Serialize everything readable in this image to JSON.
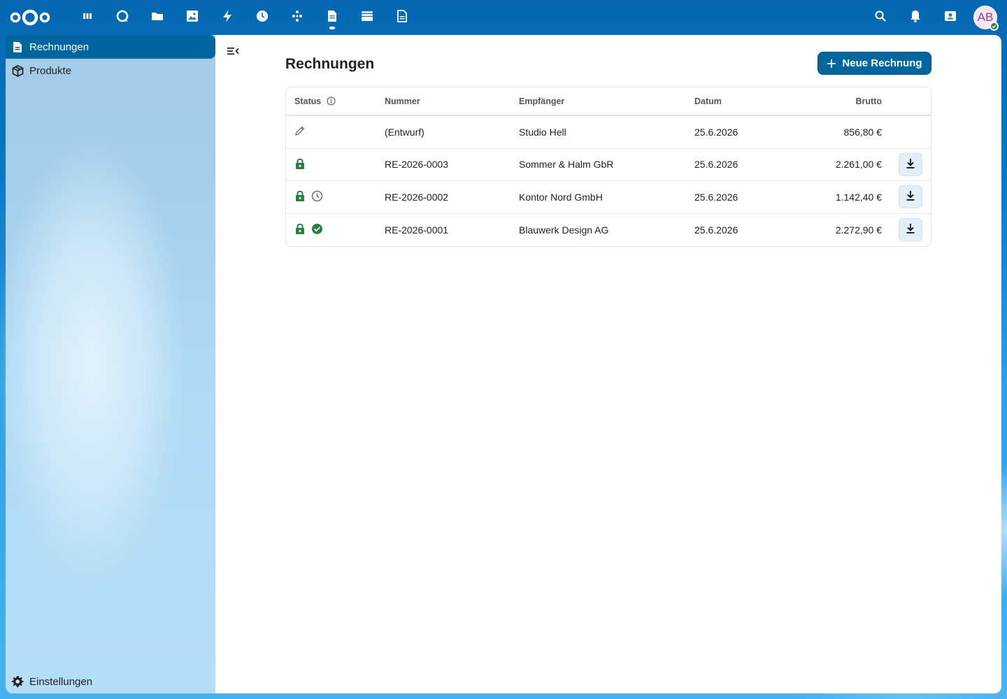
{
  "header": {
    "apps": [
      {
        "name": "dashboard"
      },
      {
        "name": "talk"
      },
      {
        "name": "files"
      },
      {
        "name": "photos"
      },
      {
        "name": "activity"
      },
      {
        "name": "timemanagement"
      },
      {
        "name": "flow"
      },
      {
        "name": "invoices",
        "active": true
      },
      {
        "name": "archive"
      },
      {
        "name": "document"
      }
    ],
    "avatar_initials": "AB"
  },
  "nav": {
    "items": [
      {
        "label": "Rechnungen",
        "active": true
      },
      {
        "label": "Produkte",
        "active": false
      }
    ],
    "settings_label": "Einstellungen"
  },
  "main": {
    "title": "Rechnungen",
    "new_button_label": "Neue Rechnung",
    "table": {
      "columns": {
        "status": "Status",
        "number": "Nummer",
        "recipient": "Empfänger",
        "date": "Datum",
        "gross": "Brutto"
      },
      "rows": [
        {
          "status": [
            "draft"
          ],
          "number": "(Entwurf)",
          "recipient": "Studio Hell",
          "date": "25.6.2026",
          "gross": "856,80 €",
          "download": false
        },
        {
          "status": [
            "locked"
          ],
          "number": "RE-2026-0003",
          "recipient": "Sommer & Halm GbR",
          "date": "25.6.2026",
          "gross": "2.261,00 €",
          "download": true
        },
        {
          "status": [
            "locked",
            "pending"
          ],
          "number": "RE-2026-0002",
          "recipient": "Kontor Nord GmbH",
          "date": "25.6.2026",
          "gross": "1.142,40 €",
          "download": true
        },
        {
          "status": [
            "locked",
            "paid"
          ],
          "number": "RE-2026-0001",
          "recipient": "Blauwerk Design AG",
          "date": "25.6.2026",
          "gross": "2.272,90 €",
          "download": true
        }
      ]
    }
  },
  "colors": {
    "primary": "#00679e",
    "locked_green": "#2d7d46",
    "muted_icon": "#6f6f6f"
  }
}
